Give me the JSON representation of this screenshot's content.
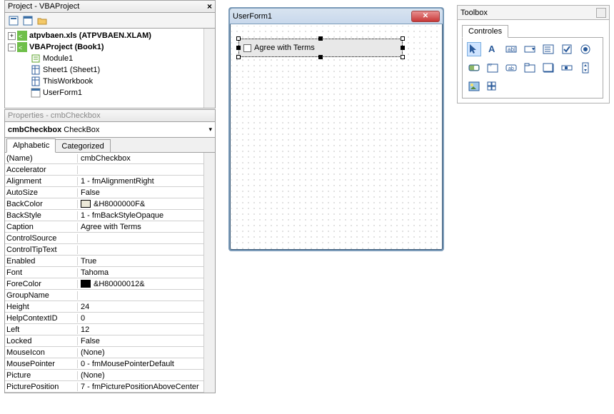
{
  "project": {
    "title": "Project - VBAProject",
    "roots": [
      {
        "label": "atpvbaen.xls (ATPVBAEN.XLAM)",
        "bold": true,
        "toggle": "+"
      },
      {
        "label": "VBAProject (Book1)",
        "bold": true,
        "toggle": "-"
      }
    ],
    "children": [
      {
        "label": "Module1",
        "icon": "module"
      },
      {
        "label": "Sheet1 (Sheet1)",
        "icon": "sheet"
      },
      {
        "label": "ThisWorkbook",
        "icon": "sheet"
      },
      {
        "label": "UserForm1",
        "icon": "form"
      }
    ]
  },
  "properties": {
    "title": "Properties - cmbCheckbox",
    "selected_bold": "cmbCheckbox",
    "selected_type": " CheckBox",
    "tabs": {
      "active": "Alphabetic",
      "other": "Categorized"
    },
    "rows": [
      {
        "k": "(Name)",
        "v": "cmbCheckbox"
      },
      {
        "k": "Accelerator",
        "v": ""
      },
      {
        "k": "Alignment",
        "v": "1 - fmAlignmentRight"
      },
      {
        "k": "AutoSize",
        "v": "False"
      },
      {
        "k": "BackColor",
        "v": "&H8000000F&",
        "swatch": "#ece9d8"
      },
      {
        "k": "BackStyle",
        "v": "1 - fmBackStyleOpaque"
      },
      {
        "k": "Caption",
        "v": "Agree with Terms"
      },
      {
        "k": "ControlSource",
        "v": ""
      },
      {
        "k": "ControlTipText",
        "v": ""
      },
      {
        "k": "Enabled",
        "v": "True"
      },
      {
        "k": "Font",
        "v": "Tahoma"
      },
      {
        "k": "ForeColor",
        "v": "&H80000012&",
        "swatch": "#000000"
      },
      {
        "k": "GroupName",
        "v": ""
      },
      {
        "k": "Height",
        "v": "24"
      },
      {
        "k": "HelpContextID",
        "v": "0"
      },
      {
        "k": "Left",
        "v": "12"
      },
      {
        "k": "Locked",
        "v": "False"
      },
      {
        "k": "MouseIcon",
        "v": "(None)"
      },
      {
        "k": "MousePointer",
        "v": "0 - fmMousePointerDefault"
      },
      {
        "k": "Picture",
        "v": "(None)"
      },
      {
        "k": "PicturePosition",
        "v": "7 - fmPicturePositionAboveCenter"
      }
    ]
  },
  "form": {
    "title": "UserForm1",
    "checkbox_caption": "Agree with Terms"
  },
  "toolbox": {
    "title": "Toolbox",
    "tab": "Controles",
    "tools": [
      "select-arrow",
      "label",
      "textbox",
      "combobox",
      "listbox",
      "checkbox",
      "optionbutton",
      "togglebutton",
      "frame",
      "commandbutton",
      "tabstrip",
      "multipage",
      "scrollbar",
      "spinbutton",
      "image",
      "refedit"
    ]
  }
}
